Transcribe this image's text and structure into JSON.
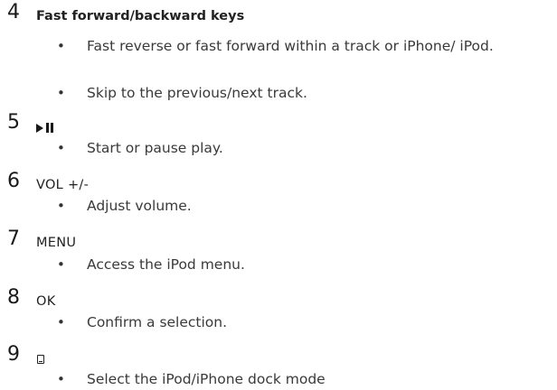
{
  "items": [
    {
      "number": "4",
      "heading": "Fast forward/backward keys",
      "bullets": [
        "Fast reverse or fast forward within a track or iPhone/ iPod.",
        "Skip to the previous/next track."
      ]
    },
    {
      "number": "5",
      "heading_icon": "play-pause-icon",
      "bullets": [
        "Start or pause play."
      ]
    },
    {
      "number": "6",
      "heading": "VOL +/-",
      "bullets": [
        "Adjust volume."
      ]
    },
    {
      "number": "7",
      "heading": "MENU",
      "bullets": [
        "Access the iPod menu."
      ]
    },
    {
      "number": "8",
      "heading": "OK",
      "bullets": [
        "Confirm a selection."
      ]
    },
    {
      "number": "9",
      "heading_icon": "dock-icon",
      "bullets": [
        "Select the iPod/iPhone dock mode"
      ]
    }
  ],
  "bullet_symbol": "•"
}
